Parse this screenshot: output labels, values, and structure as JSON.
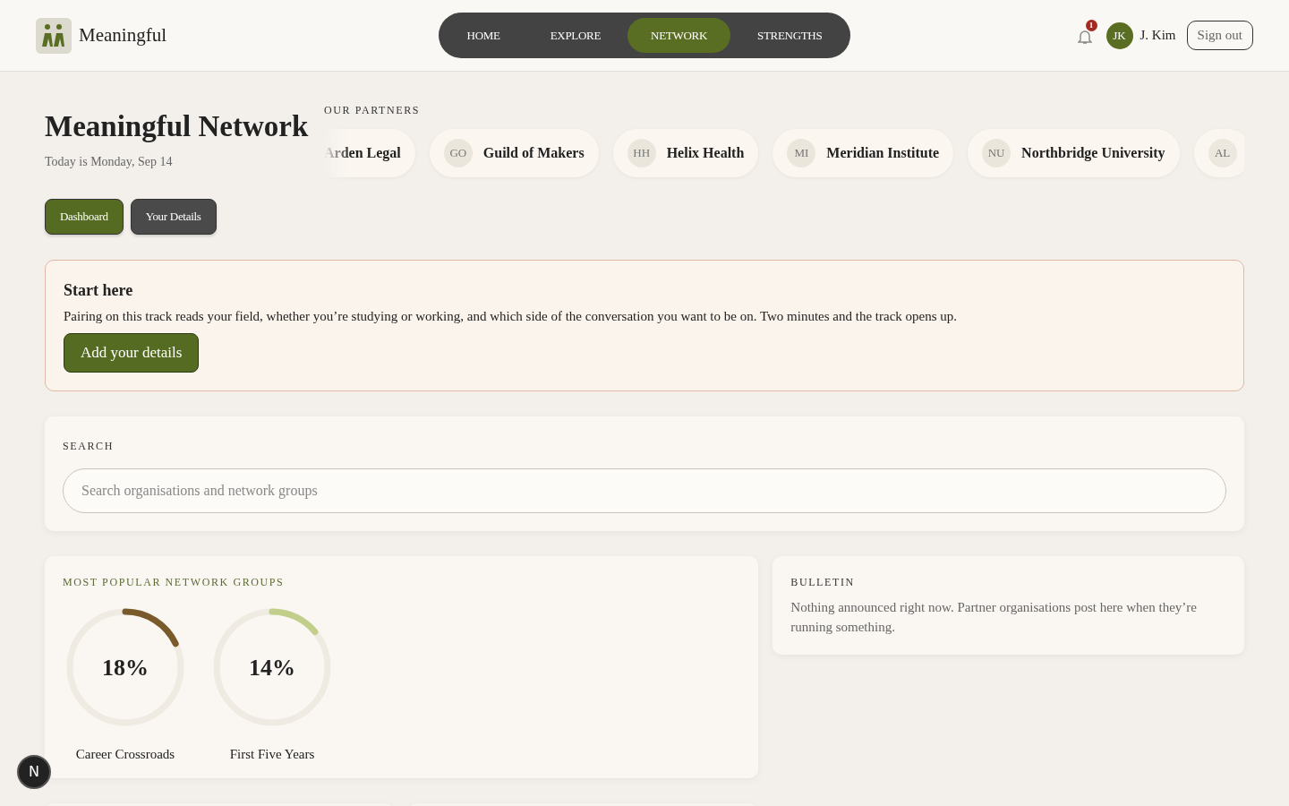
{
  "brand": {
    "name": "Meaningful"
  },
  "nav": [
    {
      "label": "HOME",
      "selected": false
    },
    {
      "label": "EXPLORE",
      "selected": false
    },
    {
      "label": "NETWORK",
      "selected": true
    },
    {
      "label": "STRENGTHS",
      "selected": false
    }
  ],
  "user": {
    "notifications": "1",
    "initials": "JK",
    "name": "J. Kim",
    "sign_out": "Sign out"
  },
  "page": {
    "title": "Meaningful Network",
    "date": "Today is Monday, Sep 14"
  },
  "partners": {
    "heading": "OUR PARTNERS",
    "items": [
      {
        "name": "Arden Legal"
      },
      {
        "initials": "GO",
        "name": "Guild of Makers"
      },
      {
        "initials": "HH",
        "name": "Helix Health"
      },
      {
        "initials": "MI",
        "name": "Meridian Institute"
      },
      {
        "initials": "NU",
        "name": "Northbridge University"
      },
      {
        "initials": "AL"
      }
    ]
  },
  "tabs": [
    {
      "label": "Dashboard",
      "selected": true
    },
    {
      "label": "Your Details",
      "selected": false
    }
  ],
  "start": {
    "title": "Start here",
    "text": "Pairing on this track reads your field, whether you’re studying or working, and which side of the conversation you want to be on. Two minutes and the track opens up.",
    "button": "Add your details"
  },
  "search": {
    "heading": "SEARCH",
    "placeholder": "Search organisations and network groups"
  },
  "popular": {
    "heading": "MOST POPULAR NETWORK GROUPS",
    "groups": [
      {
        "name": "Career Crossroads",
        "reading": "18%",
        "level": 0.18,
        "color": "#7a5a2a"
      },
      {
        "name": "First Five Years",
        "reading": "14%",
        "level": 0.14,
        "color": "#c2cf8a"
      }
    ]
  },
  "bulletin": {
    "heading": "BULLETIN",
    "text": "Nothing announced right now. Partner organisations post here when they’re running something."
  },
  "dev_badge": "N"
}
